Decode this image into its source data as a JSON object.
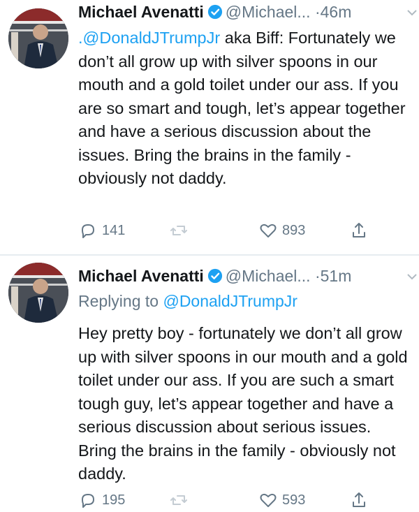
{
  "tweets": [
    {
      "author_name": "Michael Avenatti",
      "handle": "@Michael...",
      "time": "·46m",
      "mention": ".@DonaldJTrumpJr",
      "text": " aka Biff: Fortunately we don’t all grow up with silver spoons in our mouth and a gold toilet under our ass. If you are so smart and tough, let’s appear together and have a serious discussion about the issues. Bring the brains in the family - obviously not daddy.",
      "reply_count": "141",
      "like_count": "893"
    },
    {
      "author_name": "Michael Avenatti",
      "handle": "@Michael...",
      "time": "·51m",
      "replying_prefix": "Replying to ",
      "replying_to": "@DonaldJTrumpJr",
      "text": "Hey pretty boy - fortunately  we don’t all grow up with silver spoons in our mouth and a gold toilet under our ass. If you are such a smart tough guy, let’s appear together and have a serious discussion about serious issues. Bring the brains in the family - obviously not daddy.",
      "reply_count": "195",
      "like_count": "593"
    }
  ],
  "colors": {
    "link": "#1da1f2",
    "secondary_text": "#657786",
    "verified_badge": "#1da1f2"
  },
  "icons": [
    "reply-icon",
    "retweet-icon",
    "like-icon",
    "share-icon",
    "verified-badge-icon",
    "chevron-down-icon"
  ]
}
